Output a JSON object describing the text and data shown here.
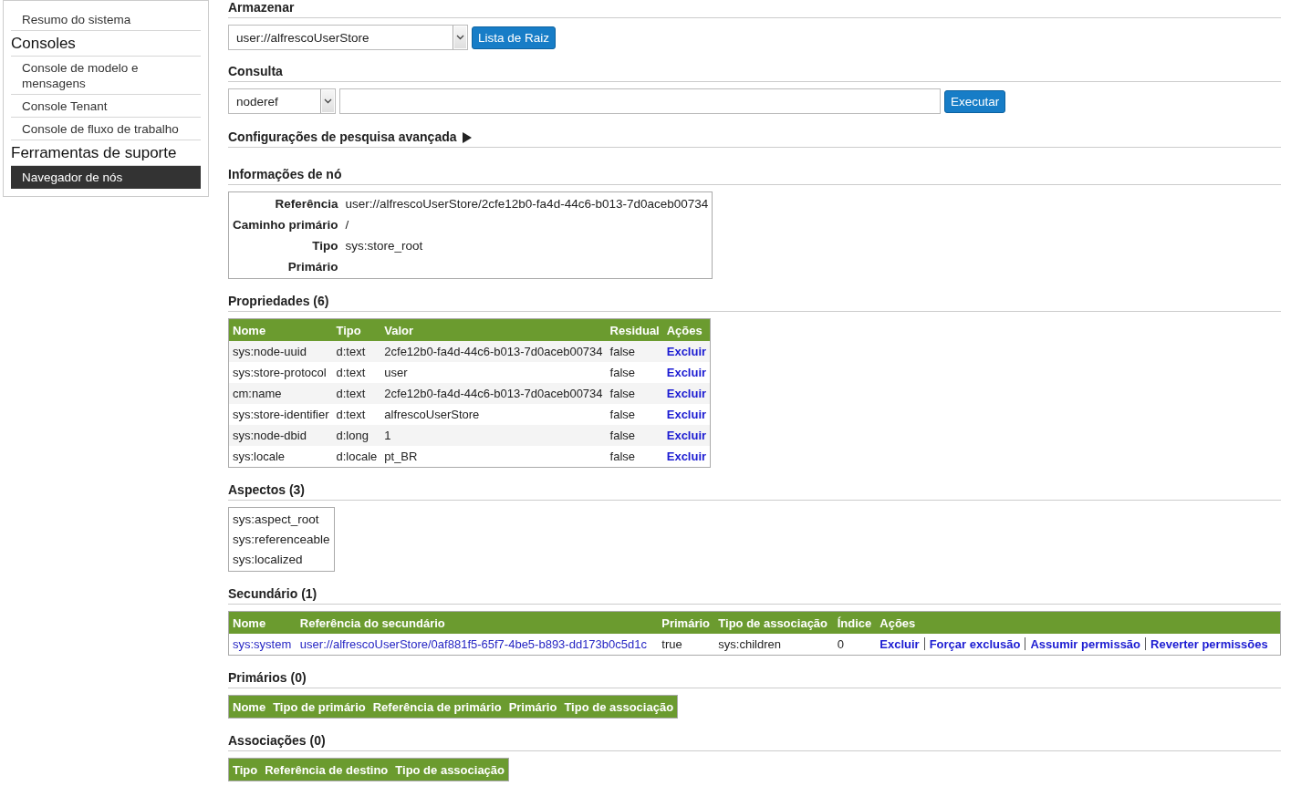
{
  "sidebar": {
    "items": [
      {
        "kind": "link",
        "label": "Resumo do sistema",
        "selected": false
      },
      {
        "kind": "heading",
        "label": "Consoles"
      },
      {
        "kind": "link",
        "label": "Console de modelo e mensagens",
        "selected": false
      },
      {
        "kind": "link",
        "label": "Console Tenant",
        "selected": false
      },
      {
        "kind": "link",
        "label": "Console de fluxo de trabalho",
        "selected": false
      },
      {
        "kind": "heading",
        "label": "Ferramentas de suporte"
      },
      {
        "kind": "link",
        "label": "Navegador de nós",
        "selected": true
      }
    ]
  },
  "store": {
    "heading": "Armazenar",
    "value": "user://alfrescoUserStore",
    "button": "Lista de Raiz"
  },
  "query": {
    "heading": "Consulta",
    "language": "noderef",
    "button": "Executar"
  },
  "advanced_search": {
    "label": "Configurações de pesquisa avançada",
    "expanded": false
  },
  "node_info": {
    "heading": "Informações de nó",
    "fields": [
      {
        "label": "Referência",
        "value": "user://alfrescoUserStore/2cfe12b0-fa4d-44c6-b013-7d0aceb00734"
      },
      {
        "label": "Caminho primário",
        "value": "/"
      },
      {
        "label": "Tipo",
        "value": "sys:store_root"
      },
      {
        "label": "Primário"
      }
    ]
  },
  "properties": {
    "heading": "Propriedades (6)",
    "columns": [
      "Nome",
      "Tipo",
      "Valor",
      "Residual",
      "Ações"
    ],
    "rows": [
      {
        "name": "sys:node-uuid",
        "type": "d:text",
        "value": "2cfe12b0-fa4d-44c6-b013-7d0aceb00734",
        "residual": "false",
        "action": "Excluir"
      },
      {
        "name": "sys:store-protocol",
        "type": "d:text",
        "value": "user",
        "residual": "false",
        "action": "Excluir"
      },
      {
        "name": "cm:name",
        "type": "d:text",
        "value": "2cfe12b0-fa4d-44c6-b013-7d0aceb00734",
        "residual": "false",
        "action": "Excluir"
      },
      {
        "name": "sys:store-identifier",
        "type": "d:text",
        "value": "alfrescoUserStore",
        "residual": "false",
        "action": "Excluir"
      },
      {
        "name": "sys:node-dbid",
        "type": "d:long",
        "value": "1",
        "residual": "false",
        "action": "Excluir"
      },
      {
        "name": "sys:locale",
        "type": "d:locale",
        "value": "pt_BR",
        "residual": "false",
        "action": "Excluir"
      }
    ]
  },
  "aspects": {
    "heading": "Aspectos (3)",
    "items": [
      "sys:aspect_root",
      "sys:referenceable",
      "sys:localized"
    ]
  },
  "secondary": {
    "heading": "Secundário (1)",
    "columns": [
      "Nome",
      "Referência do secundário",
      "Primário",
      "Tipo de associação",
      "Índice",
      "Ações"
    ],
    "rows": [
      {
        "name": "sys:system",
        "reference": "user://alfrescoUserStore/0af881f5-65f7-4be5-b893-dd173b0c5d1c",
        "primary": "true",
        "association_type": "sys:children",
        "index": "0",
        "actions": [
          "Excluir",
          "Forçar exclusão",
          "Assumir permissão",
          "Reverter permissões"
        ]
      }
    ]
  },
  "parents": {
    "heading": "Primários (0)",
    "columns": [
      "Nome",
      "Tipo de primário",
      "Referência de primário",
      "Primário",
      "Tipo de associação"
    ]
  },
  "associations": {
    "heading": "Associações (0)",
    "columns": [
      "Tipo",
      "Referência de destino",
      "Tipo de associação"
    ]
  }
}
